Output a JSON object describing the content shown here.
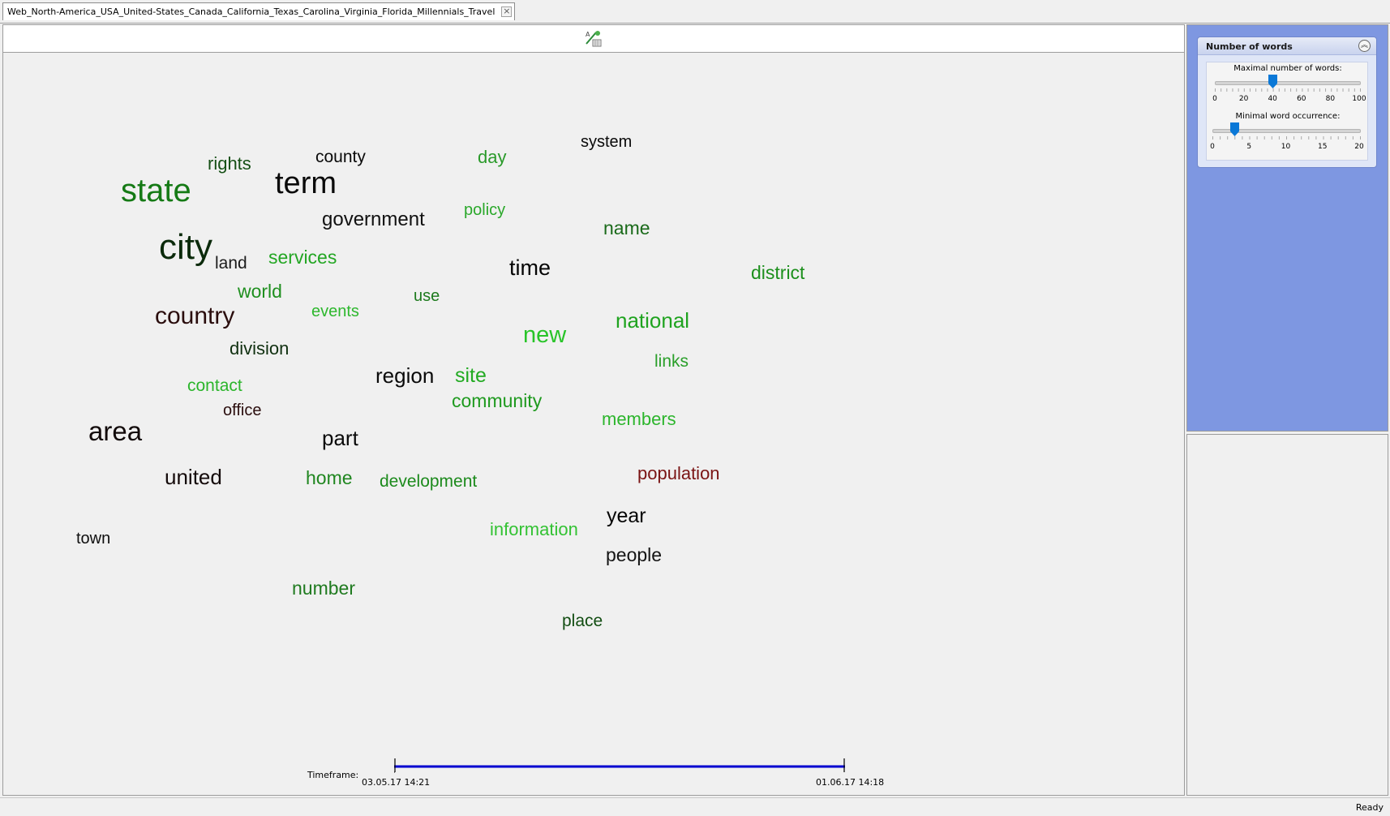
{
  "tab": {
    "title": "Web_North-America_USA_United-States_Canada_California_Texas_Carolina_Virginia_Florida_Millennials_Travel",
    "close_icon": "close-icon"
  },
  "toolbar": {
    "tool_icon": "cloud-settings-icon"
  },
  "word_cloud": [
    {
      "text": "state",
      "color": "#157a15"
    },
    {
      "text": "city",
      "color": "#0b2a0b"
    },
    {
      "text": "term",
      "color": "#0a0a0a"
    },
    {
      "text": "area",
      "color": "#120a0a"
    },
    {
      "text": "country",
      "color": "#2a0d0d"
    },
    {
      "text": "new",
      "color": "#28c428"
    },
    {
      "text": "time",
      "color": "#050505"
    },
    {
      "text": "national",
      "color": "#1fa31f"
    },
    {
      "text": "part",
      "color": "#0a0a0a"
    },
    {
      "text": "region",
      "color": "#0a0a0a"
    },
    {
      "text": "government",
      "color": "#111111"
    },
    {
      "text": "united",
      "color": "#140a0a"
    },
    {
      "text": "year",
      "color": "#050505"
    },
    {
      "text": "name",
      "color": "#1a6a1a"
    },
    {
      "text": "people",
      "color": "#141414"
    },
    {
      "text": "site",
      "color": "#22aa22"
    },
    {
      "text": "district",
      "color": "#1c8f1c"
    },
    {
      "text": "population",
      "color": "#7a1414"
    },
    {
      "text": "community",
      "color": "#1f9a1f"
    },
    {
      "text": "home",
      "color": "#1f861f"
    },
    {
      "text": "development",
      "color": "#1c8a1c"
    },
    {
      "text": "services",
      "color": "#23a623"
    },
    {
      "text": "number",
      "color": "#1f7a1f"
    },
    {
      "text": "members",
      "color": "#2cb52c"
    },
    {
      "text": "information",
      "color": "#33c233"
    },
    {
      "text": "world",
      "color": "#1f8f1f"
    },
    {
      "text": "division",
      "color": "#103010"
    },
    {
      "text": "place",
      "color": "#124d12"
    },
    {
      "text": "rights",
      "color": "#165016"
    },
    {
      "text": "county",
      "color": "#0a0a0a"
    },
    {
      "text": "day",
      "color": "#2a9a2a"
    },
    {
      "text": "system",
      "color": "#0a0a0a"
    },
    {
      "text": "events",
      "color": "#2eb82e"
    },
    {
      "text": "use",
      "color": "#1d7a1d"
    },
    {
      "text": "links",
      "color": "#2a9f2a"
    },
    {
      "text": "contact",
      "color": "#2bb52b"
    },
    {
      "text": "policy",
      "color": "#2aa82a"
    },
    {
      "text": "office",
      "color": "#2a0d0d"
    },
    {
      "text": "land",
      "color": "#1c1c1c"
    },
    {
      "text": "town",
      "color": "#0f0f0f"
    }
  ],
  "timeframe": {
    "label": "Timeframe:",
    "start": "03.05.17 14:21",
    "end": "01.06.17 14:18",
    "line_color": "#0000d0"
  },
  "panel": {
    "title": "Number of words",
    "collapse_icon": "collapse-up-icon",
    "max_words": {
      "label": "Maximal number of words:",
      "value": 40,
      "min": 0,
      "max": 100,
      "ticks": [
        "0",
        "20",
        "40",
        "60",
        "80",
        "100"
      ]
    },
    "min_occurrence": {
      "label": "Minimal word occurrence:",
      "value": 3,
      "min": 0,
      "max": 20,
      "ticks": [
        "0",
        "5",
        "10",
        "15",
        "20"
      ]
    },
    "accent": "#0a78d7",
    "background": "#7e97e1"
  },
  "status": {
    "text": "Ready"
  }
}
